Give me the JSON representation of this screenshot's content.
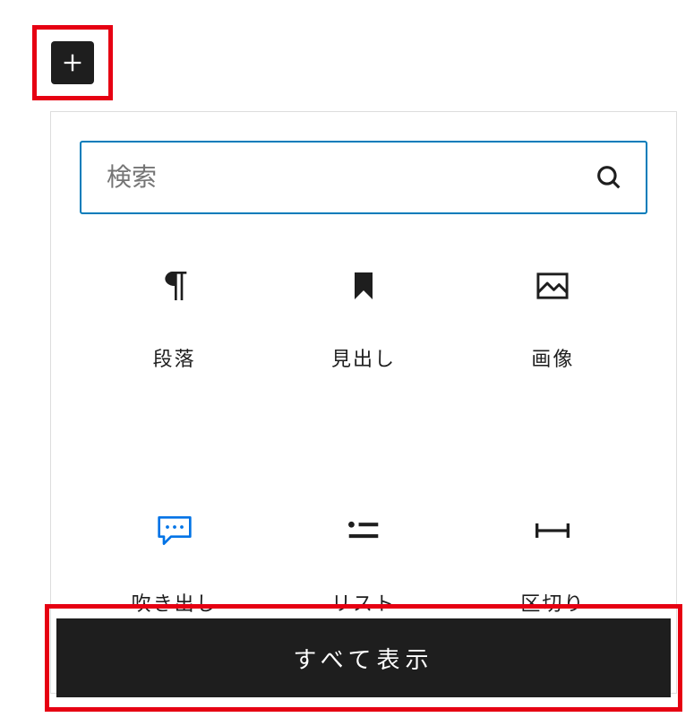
{
  "add_button": {
    "name": "add-block"
  },
  "search": {
    "placeholder": "検索"
  },
  "blocks": [
    {
      "id": "paragraph",
      "label": "段落"
    },
    {
      "id": "heading",
      "label": "見出し"
    },
    {
      "id": "image",
      "label": "画像"
    },
    {
      "id": "balloon",
      "label": "吹き出し"
    },
    {
      "id": "list",
      "label": "リスト"
    },
    {
      "id": "separator",
      "label": "区切り"
    }
  ],
  "show_all_label": "すべて表示"
}
